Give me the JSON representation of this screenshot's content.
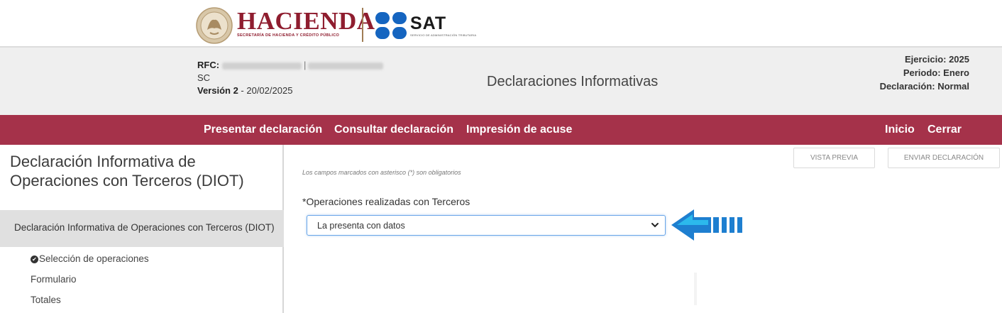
{
  "header": {
    "hacienda_name": "HACIENDA",
    "hacienda_subtitle": "SECRETARÍA DE HACIENDA Y CRÉDITO PÚBLICO",
    "sat_name": "SAT",
    "sat_subtitle": "SERVICIO DE ADMINISTRACIÓN TRIBUTARIA"
  },
  "taxpayer": {
    "rfc_label": "RFC:",
    "regime": "SC",
    "version_label": "Versión 2",
    "version_date": " - 20/02/2025"
  },
  "page_title": "Declaraciones Informativas",
  "declaration_info": {
    "ejercicio": "Ejercicio: 2025",
    "periodo": "Periodo: Enero",
    "declaracion": "Declaración: Normal"
  },
  "nav": {
    "presentar": "Presentar declaración",
    "consultar": "Consultar declaración",
    "impresion": "Impresión de acuse",
    "inicio": "Inicio",
    "cerrar": "Cerrar"
  },
  "sidebar": {
    "title": "Declaración Informativa de Operaciones con Terceros (DIOT)",
    "active_section": "Declaración Informativa de Operaciones con Terceros (DIOT)",
    "items": [
      {
        "label": "Selección de operaciones",
        "checked": true
      },
      {
        "label": "Formulario",
        "checked": false
      },
      {
        "label": "Totales",
        "checked": false
      }
    ]
  },
  "actions": {
    "preview": "VISTA PREVIA",
    "send": "ENVIAR DECLARACIÓN"
  },
  "form": {
    "required_note": "Los campos marcados con asterisco (*) son obligatorios",
    "operations_label": "*Operaciones realizadas con Terceros",
    "operations_value": "La presenta con datos"
  },
  "colors": {
    "navbar": "#a5324a",
    "hacienda_red": "#8f1d2f",
    "sat_blue": "#1565c0",
    "pointer_blue": "#1e7fd0"
  }
}
